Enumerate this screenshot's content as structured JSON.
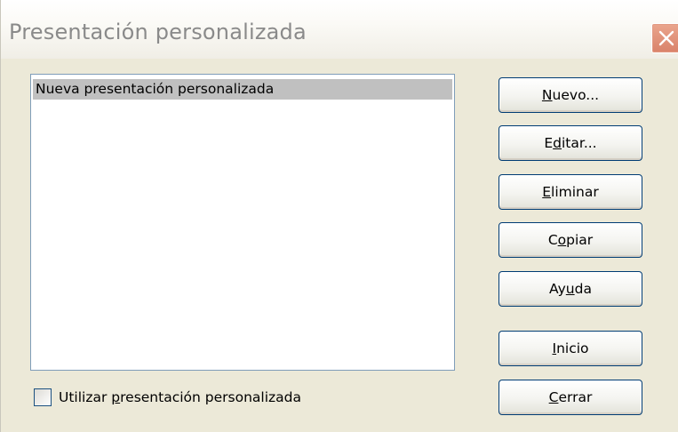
{
  "window": {
    "title": "Presentación personalizada",
    "close_icon": "close-icon"
  },
  "list": {
    "items": [
      {
        "label": "Nueva presentación personalizada",
        "selected": true
      }
    ]
  },
  "checkbox": {
    "label_pre": "Utilizar ",
    "label_mnemonic": "p",
    "label_post": "resentación personalizada",
    "checked": false
  },
  "buttons": {
    "nuevo": {
      "pre": "",
      "mn": "N",
      "post": "uevo..."
    },
    "editar": {
      "pre": "E",
      "mn": "d",
      "post": "itar..."
    },
    "eliminar": {
      "pre": "",
      "mn": "E",
      "post": "liminar"
    },
    "copiar": {
      "pre": "C",
      "mn": "o",
      "post": "piar"
    },
    "ayuda": {
      "pre": "Ay",
      "mn": "u",
      "post": "da"
    },
    "inicio": {
      "pre": "",
      "mn": "I",
      "post": "nicio"
    },
    "cerrar": {
      "pre": "",
      "mn": "C",
      "post": "errar"
    }
  },
  "colors": {
    "dialog_bg": "#ece9d8",
    "selection": "#c0c0c0",
    "close_button": "#d9826a",
    "button_border": "#003c74"
  }
}
